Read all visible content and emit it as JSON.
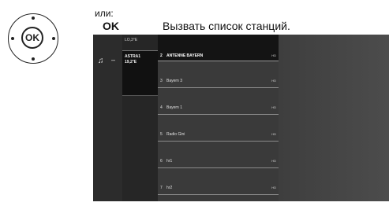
{
  "instruction": {
    "or_label": "или:",
    "ok_key": "OK",
    "description": "Вызвать список станций."
  },
  "remote": {
    "ok_label": "OK"
  },
  "screen": {
    "satellite_top": "LO,3°E",
    "satellite_active_line1": "ASTRA1",
    "satellite_active_line2": "19,2°E",
    "channels": [
      {
        "num": "2",
        "name": "ANTENNE BAYERN",
        "badge": "HD",
        "selected": true
      },
      {
        "num": "3",
        "name": "Bayern 3",
        "badge": "HD"
      },
      {
        "num": "4",
        "name": "Bayern 1",
        "badge": "HD"
      },
      {
        "num": "5",
        "name": "Radio Gini",
        "badge": "HD"
      },
      {
        "num": "6",
        "name": "hr1",
        "badge": "HD"
      },
      {
        "num": "7",
        "name": "hr2",
        "badge": "HD"
      }
    ]
  },
  "colors": {
    "screen_bg": "#333333",
    "selected_row": "#141414"
  },
  "icons": {
    "remote": "remote-ok-button-icon",
    "music": "music-note-icon"
  }
}
